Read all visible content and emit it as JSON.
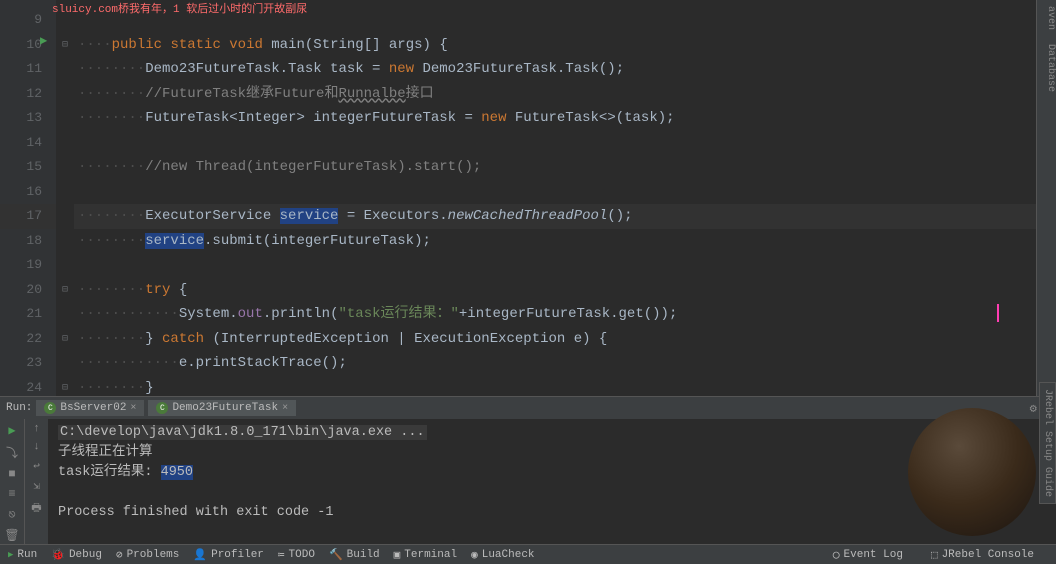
{
  "top_text": "sluicy.com桥我有年，1 软后过小时的门开故副尿",
  "gutter": [
    "9",
    "10",
    "11",
    "12",
    "13",
    "14",
    "15",
    "16",
    "17",
    "18",
    "19",
    "20",
    "21",
    "22",
    "23",
    "24"
  ],
  "code": {
    "l10": {
      "pre": "····",
      "k1": "public",
      "k2": "static",
      "k3": "void",
      "m": "main",
      "rest": "(String[] args) {"
    },
    "l11": {
      "pre": "········",
      "a": "Demo23FutureTask.Task task = ",
      "k": "new",
      "b": " Demo23FutureTask.Task();"
    },
    "l12": {
      "pre": "········",
      "c": "//FutureTask继承Future和",
      "u": "Runnalbe",
      "d": "接口"
    },
    "l13": {
      "pre": "········",
      "a": "FutureTask<Integer> integerFutureTask = ",
      "k": "new",
      "b": " FutureTask<>(task);"
    },
    "l15": {
      "pre": "········",
      "c": "//new Thread(integerFutureTask).start();"
    },
    "l17": {
      "pre": "········",
      "a": "ExecutorService ",
      "sel": "service",
      "b": " = Executors.",
      "m": "newCachedThreadPool",
      "c": "();"
    },
    "l18": {
      "pre": "········",
      "sel": "service",
      "a": ".submit(integerFutureTask);"
    },
    "l20": {
      "pre": "········",
      "k": "try",
      "a": " {"
    },
    "l21": {
      "pre": "············",
      "a": "System.",
      "f": "out",
      "b": ".println(",
      "s": "\"task运行结果：\"",
      "c": "+integerFutureTask.get());"
    },
    "l22": {
      "pre": "········",
      "a": "} ",
      "k": "catch",
      "b": " (InterruptedException | ExecutionException e) {"
    },
    "l23": {
      "pre": "············",
      "a": "e.printStackTrace();"
    },
    "l24": {
      "pre": "········",
      "a": "}"
    }
  },
  "run": {
    "label": "Run:",
    "tab1": "BsServer02",
    "tab2": "Demo23FutureTask",
    "cmd": "C:\\develop\\java\\jdk1.8.0_171\\bin\\java.exe ...",
    "out1": "子线程正在计算",
    "out2a": "task运行结果: ",
    "out2b": "4950",
    "out3": "Process finished with exit code -1"
  },
  "status": {
    "run": "Run",
    "debug": "Debug",
    "problems": "Problems",
    "profiler": "Profiler",
    "todo": "TODO",
    "build": "Build",
    "terminal": "Terminal",
    "lua": "LuaCheck",
    "eventlog": "Event Log",
    "jrebel": "JRebel Console"
  },
  "right_tabs": {
    "maven": "aven",
    "db": "Database"
  },
  "guide": "JRebel Setup Guide"
}
